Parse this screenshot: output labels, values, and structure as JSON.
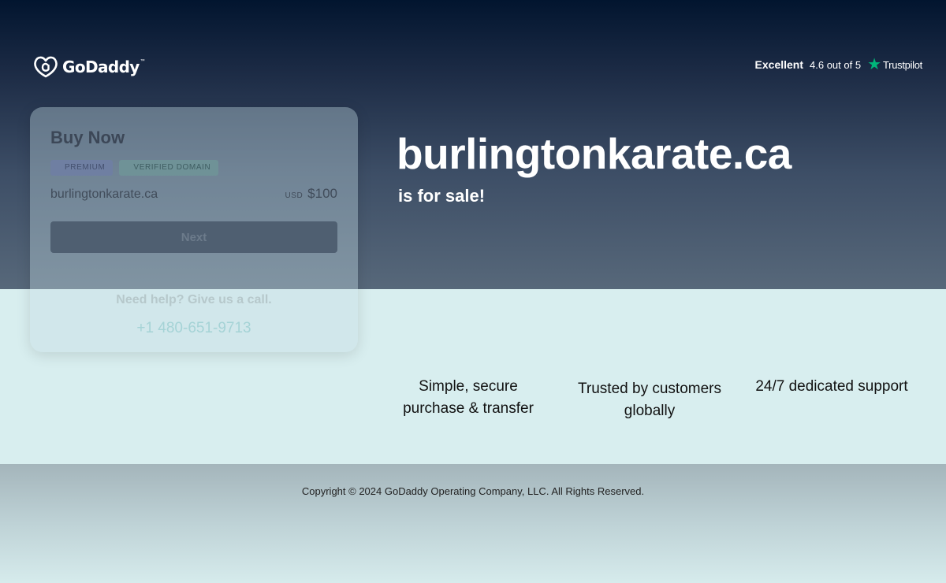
{
  "header": {
    "logo": {
      "text": "GoDaddy",
      "tm": "™"
    },
    "trustpilot": {
      "rating_word": "Excellent",
      "score": "4.6 out of 5",
      "brand": "Trustpilot",
      "star_color": "#00b67a"
    }
  },
  "buy_card": {
    "title": "Buy Now",
    "badges": [
      "PREMIUM",
      "VERIFIED DOMAIN"
    ],
    "domain": "burlingtonkarate.ca",
    "currency": "USD",
    "price": "$100",
    "next_label": "Next",
    "help_text": "Need help? Give us a call.",
    "phone": "+1 480-651-9713"
  },
  "hero": {
    "domain": "burlingtonkarate.ca",
    "subtitle": "is for sale!"
  },
  "features": [
    {
      "line1": "Simple, secure",
      "line2": "purchase & transfer"
    },
    {
      "line1": "Trusted by customers",
      "line2": "globally"
    },
    {
      "line1": "24/7 dedicated support",
      "line2": ""
    }
  ],
  "footer": {
    "copyright": "Copyright © 2024 GoDaddy Operating Company, LLC. All Rights Reserved."
  }
}
